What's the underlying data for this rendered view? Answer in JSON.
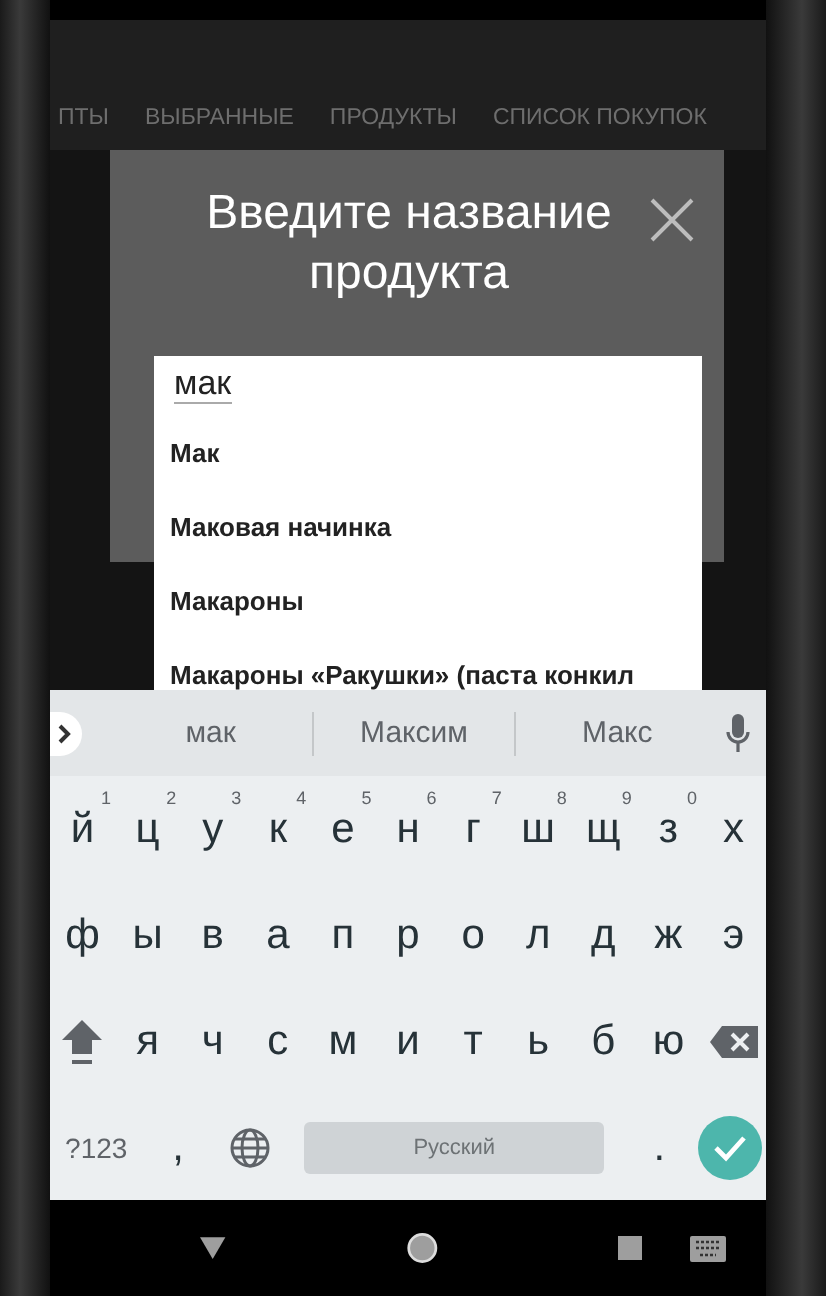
{
  "tabs": [
    {
      "label": "ПТЫ",
      "selected": false
    },
    {
      "label": "ВЫБРАННЫЕ",
      "selected": false
    },
    {
      "label": "ПРОДУКТЫ",
      "selected": false
    },
    {
      "label": "СПИСОК ПОКУПОК",
      "selected": false
    }
  ],
  "dialog": {
    "title": "Введите название продукта",
    "input": {
      "value": "мак"
    },
    "suggestions": [
      "Мак",
      "Маковая начинка",
      "Макароны",
      "Макароны «Ракушки» (паста конкил"
    ]
  },
  "keyboard": {
    "suggestions": [
      "мак",
      "Максим",
      "Макс"
    ],
    "rows": [
      [
        {
          "kind": "letter",
          "label": "й",
          "hint": "1"
        },
        {
          "kind": "letter",
          "label": "ц",
          "hint": "2"
        },
        {
          "kind": "letter",
          "label": "у",
          "hint": "3"
        },
        {
          "kind": "letter",
          "label": "к",
          "hint": "4"
        },
        {
          "kind": "letter",
          "label": "е",
          "hint": "5"
        },
        {
          "kind": "letter",
          "label": "н",
          "hint": "6"
        },
        {
          "kind": "letter",
          "label": "г",
          "hint": "7"
        },
        {
          "kind": "letter",
          "label": "ш",
          "hint": "8"
        },
        {
          "kind": "letter",
          "label": "щ",
          "hint": "9"
        },
        {
          "kind": "letter",
          "label": "з",
          "hint": "0"
        },
        {
          "kind": "letter",
          "label": "х"
        }
      ],
      [
        {
          "kind": "letter",
          "label": "ф"
        },
        {
          "kind": "letter",
          "label": "ы"
        },
        {
          "kind": "letter",
          "label": "в"
        },
        {
          "kind": "letter",
          "label": "а"
        },
        {
          "kind": "letter",
          "label": "п"
        },
        {
          "kind": "letter",
          "label": "р"
        },
        {
          "kind": "letter",
          "label": "о"
        },
        {
          "kind": "letter",
          "label": "л"
        },
        {
          "kind": "letter",
          "label": "д"
        },
        {
          "kind": "letter",
          "label": "ж"
        },
        {
          "kind": "letter",
          "label": "э"
        }
      ],
      [
        {
          "kind": "shift"
        },
        {
          "kind": "letter",
          "label": "я"
        },
        {
          "kind": "letter",
          "label": "ч"
        },
        {
          "kind": "letter",
          "label": "с"
        },
        {
          "kind": "letter",
          "label": "м"
        },
        {
          "kind": "letter",
          "label": "и"
        },
        {
          "kind": "letter",
          "label": "т"
        },
        {
          "kind": "letter",
          "label": "ь"
        },
        {
          "kind": "letter",
          "label": "б"
        },
        {
          "kind": "letter",
          "label": "ю"
        },
        {
          "kind": "backspace"
        }
      ]
    ],
    "bottom_row": [
      {
        "kind": "symbols",
        "label": "?123"
      },
      {
        "kind": "letter",
        "label": ","
      },
      {
        "kind": "globe"
      },
      {
        "kind": "space",
        "label": "Русский"
      },
      {
        "kind": "letter",
        "label": "."
      },
      {
        "kind": "enter"
      }
    ]
  }
}
